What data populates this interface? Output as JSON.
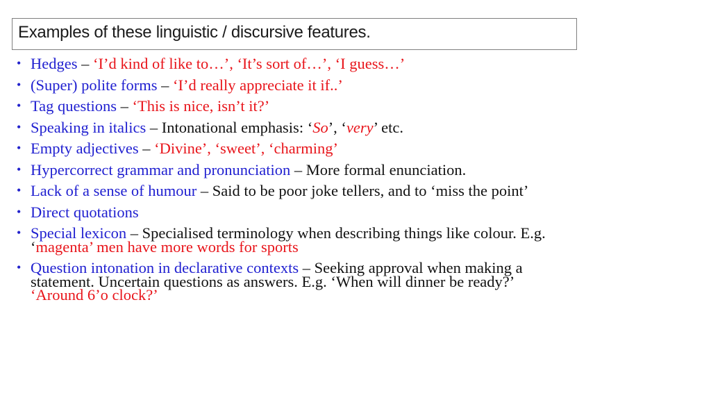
{
  "title": "Examples of these linguistic / discursive features.",
  "colors": {
    "term": "#1f1fd0",
    "example": "#e8151b",
    "text": "#111111",
    "border": "#7f7f7f"
  },
  "bullet_icon": "•",
  "items": [
    {
      "term": "Hedges",
      "dash": " – ",
      "red": "‘I’d kind of like to…’, ‘It’s sort of…’, ‘I guess…’"
    },
    {
      "term": "(Super) polite forms",
      "dash": " – ",
      "red": "‘I’d really appreciate it if..’"
    },
    {
      "term": "Tag questions",
      "dash": " – ",
      "red": "‘This is nice, isn’t it?’"
    },
    {
      "term": "Speaking in italics",
      "desc": " – Intonational emphasis: ‘",
      "it1": "So",
      "mid": "’, ‘",
      "it2": "very",
      "end": "’ etc."
    },
    {
      "term": "Empty adjectives",
      "dash": " – ",
      "red": "‘Divine’, ‘sweet’, ‘charming’"
    },
    {
      "term": "Hypercorrect grammar and pronunciation",
      "desc": " – More formal enunciation."
    },
    {
      "term": "Lack of a sense of humour",
      "desc": " – Said to be poor joke tellers, and to ‘miss the point’"
    },
    {
      "term": "Direct quotations"
    },
    {
      "term": "Special lexicon",
      "desc": " – Specialised terminology when describing things like colour. E.g. ‘",
      "red": "magenta’ men have more words for sports"
    },
    {
      "term": "Question intonation in declarative contexts",
      "desc": " – Seeking approval when making a statement. Uncertain questions as answers. E.g. ‘When will dinner be ready?’ ",
      "red": "‘Around 6’o clock?’"
    }
  ]
}
